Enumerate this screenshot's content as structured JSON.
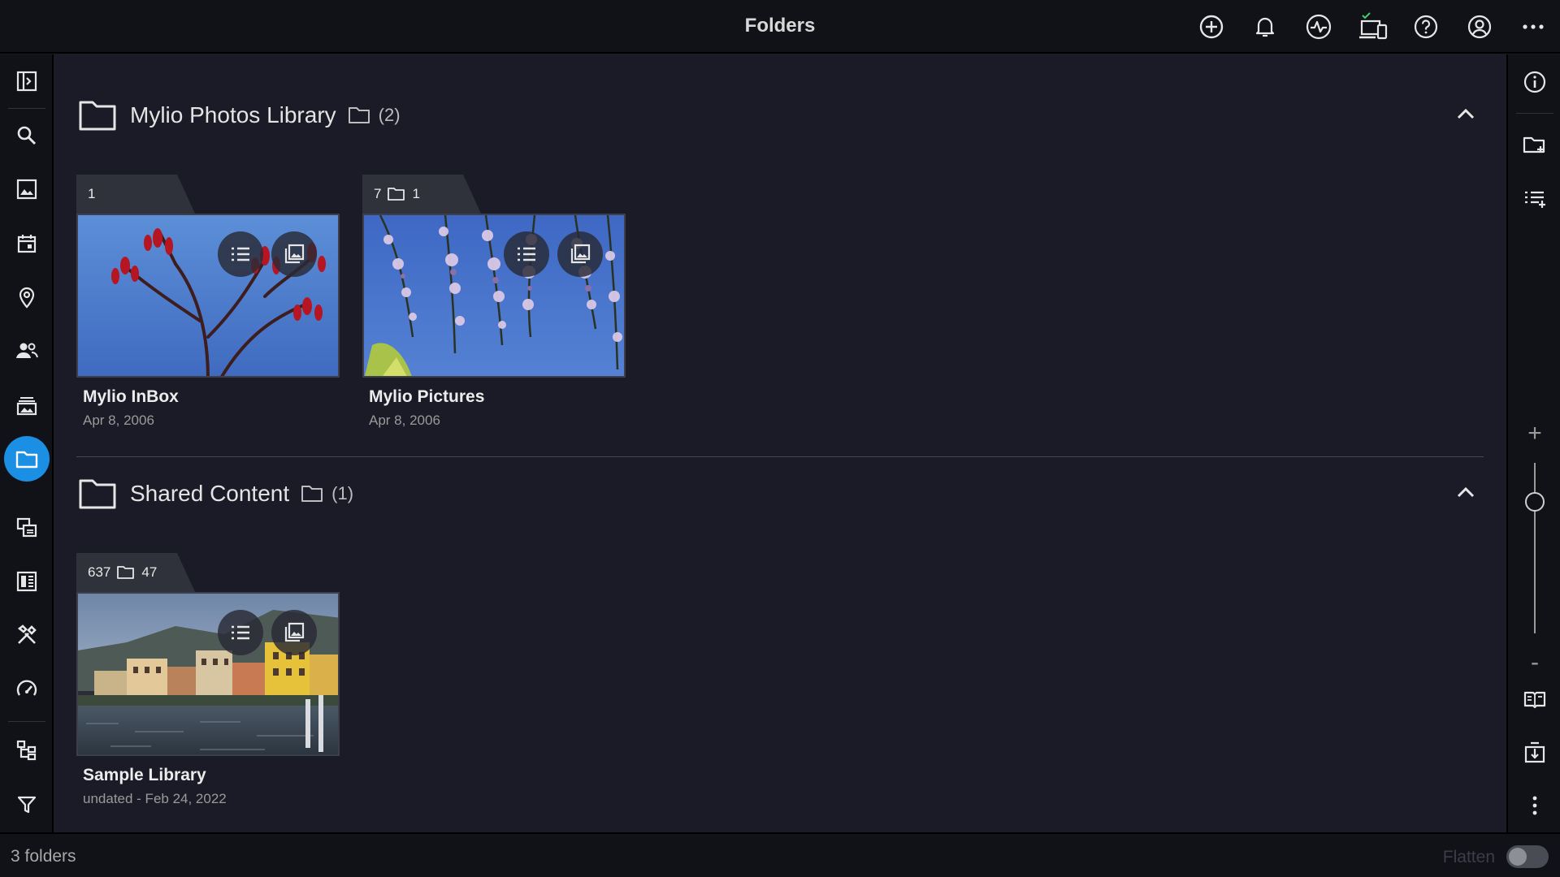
{
  "topbar": {
    "title": "Folders",
    "icons": [
      "add-circle-icon",
      "bell-icon",
      "activity-icon",
      "devices-icon",
      "help-icon",
      "account-icon",
      "more-horizontal-icon"
    ]
  },
  "left_sidebar": {
    "items": [
      {
        "name": "panel-toggle-icon"
      },
      {
        "name": "search-icon"
      },
      {
        "name": "photos-icon"
      },
      {
        "name": "calendar-icon"
      },
      {
        "name": "map-pin-icon"
      },
      {
        "name": "people-icon"
      },
      {
        "name": "albums-icon"
      },
      {
        "name": "folders-icon",
        "active": true
      },
      {
        "name": "duplicates-icon"
      },
      {
        "name": "dashboard-icon"
      },
      {
        "name": "tools-icon"
      },
      {
        "name": "speed-icon"
      },
      {
        "name": "hierarchy-icon"
      },
      {
        "name": "filter-icon"
      }
    ]
  },
  "right_sidebar": {
    "items": [
      "info-icon",
      "new-folder-icon",
      "add-to-list-icon",
      "zoom-in-icon",
      "zoom-out-icon",
      "book-icon",
      "import-icon",
      "more-vertical-icon"
    ],
    "zoom_plus": "+",
    "zoom_minus": "-"
  },
  "sections": [
    {
      "name": "Mylio Photos Library",
      "count": "(2)",
      "cards": [
        {
          "name": "Mylio InBox",
          "date": "Apr 8, 2006",
          "photos": "1",
          "folders": ""
        },
        {
          "name": "Mylio Pictures",
          "date": "Apr 8, 2006",
          "photos": "7",
          "folders": "1"
        }
      ]
    },
    {
      "name": "Shared Content",
      "count": "(1)",
      "cards": [
        {
          "name": "Sample Library",
          "date": "undated - Feb 24, 2022",
          "photos": "637",
          "folders": "47"
        }
      ]
    }
  ],
  "statusbar": {
    "count": "3 folders",
    "flatten_label": "Flatten",
    "flatten_on": false
  },
  "colors": {
    "background": "#1a1b26",
    "chrome": "#111218",
    "accent": "#1a8fe3"
  }
}
